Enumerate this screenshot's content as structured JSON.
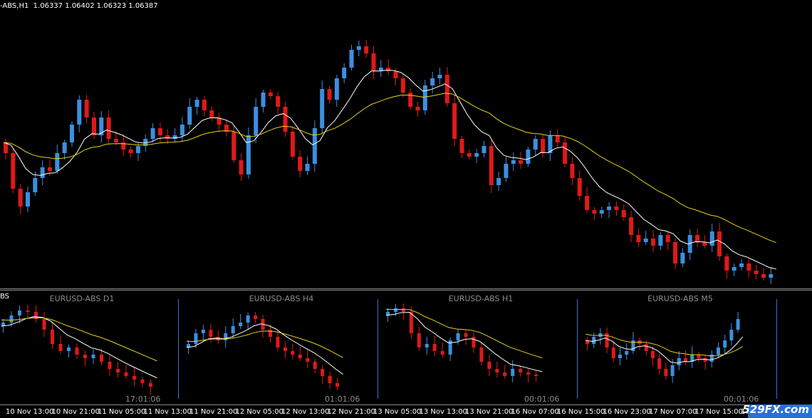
{
  "chart_label": "-ABS,H1  1.06337 1.06402 1.06323 1.06387",
  "sub_label": "BS",
  "panels": [
    {
      "title": "EURUSD-ABS D1",
      "time": "17:01:06"
    },
    {
      "title": "EURUSD-ABS H4",
      "time": "01:01:06"
    },
    {
      "title": "EURUSD-ABS H1",
      "time": "00:01:06"
    },
    {
      "title": "EURUSD-ABS M5",
      "time": "00:01:06"
    }
  ],
  "x_ticks": [
    "10 Nov 13:00",
    "10 Nov 21:00",
    "11 Nov 05:00",
    "11 Nov 13:00",
    "11 Nov 21:00",
    "12 Nov 05:00",
    "12 Nov 13:00",
    "12 Nov 21:00",
    "13 Nov 05:00",
    "13 Nov 13:00",
    "13 Nov 21:00",
    "16 Nov 07:00",
    "16 Nov 15:00",
    "16 Nov 23:00",
    "17 Nov 07:00",
    "17 Nov 15:00",
    "17 N"
  ],
  "watermark": "529FX.com",
  "colors": {
    "bull": "#3c8fe0",
    "bear": "#e01919",
    "ma_fast": "#ffffff",
    "ma_slow": "#e6d21a",
    "background": "#000000"
  },
  "chart_data": {
    "type": "candlestick",
    "symbol": "EURUSD-ABS",
    "timeframe": "H1",
    "last_bar": {
      "open": 1.06337,
      "high": 1.06402,
      "low": 1.06323,
      "close": 1.06387
    }
  }
}
